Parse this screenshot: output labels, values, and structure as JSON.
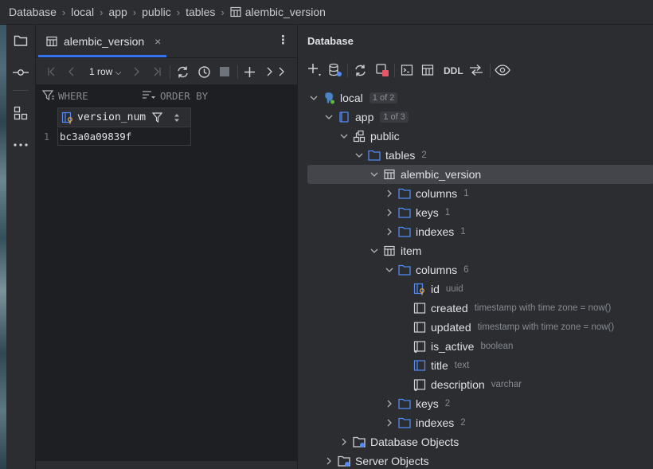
{
  "breadcrumb": {
    "items": [
      "Database",
      "local",
      "app",
      "public",
      "tables",
      "alembic_version"
    ]
  },
  "editor": {
    "tab": {
      "label": "alembic_version"
    },
    "toolbar": {
      "rows_label": "1 row"
    },
    "filter": {
      "where_label": "WHERE",
      "order_by_label": "ORDER BY"
    },
    "grid": {
      "column": "version_num",
      "rows": [
        {
          "num": "1",
          "value": "bc3a0a09839f"
        }
      ]
    }
  },
  "database_panel": {
    "title": "Database",
    "toolbar": {
      "ddl_label": "DDL"
    },
    "tree": {
      "local": {
        "label": "local",
        "badge": "1 of 2"
      },
      "app": {
        "label": "app",
        "badge": "1 of 3"
      },
      "public": {
        "label": "public"
      },
      "tables": {
        "label": "tables",
        "count": "2"
      },
      "alembic_version": {
        "label": "alembic_version"
      },
      "av_columns": {
        "label": "columns",
        "count": "1"
      },
      "av_keys": {
        "label": "keys",
        "count": "1"
      },
      "av_indexes": {
        "label": "indexes",
        "count": "1"
      },
      "item": {
        "label": "item"
      },
      "item_columns": {
        "label": "columns",
        "count": "6"
      },
      "col_id": {
        "label": "id",
        "hint": "uuid"
      },
      "col_created": {
        "label": "created",
        "hint": "timestamp with time zone = now()"
      },
      "col_updated": {
        "label": "updated",
        "hint": "timestamp with time zone = now()"
      },
      "col_is_active": {
        "label": "is_active",
        "hint": "boolean"
      },
      "col_title": {
        "label": "title",
        "hint": "text"
      },
      "col_description": {
        "label": "description",
        "hint": "varchar"
      },
      "item_keys": {
        "label": "keys",
        "count": "2"
      },
      "item_indexes": {
        "label": "indexes",
        "count": "2"
      },
      "db_objects": {
        "label": "Database Objects"
      },
      "server_objects": {
        "label": "Server Objects"
      }
    }
  },
  "colors": {
    "accent": "#3574f0",
    "folder": "#548af7",
    "selection": "#43454a",
    "panel_bg": "#2b2d30",
    "editor_bg": "#1e1f22",
    "key_gold": "#e0a53b"
  }
}
